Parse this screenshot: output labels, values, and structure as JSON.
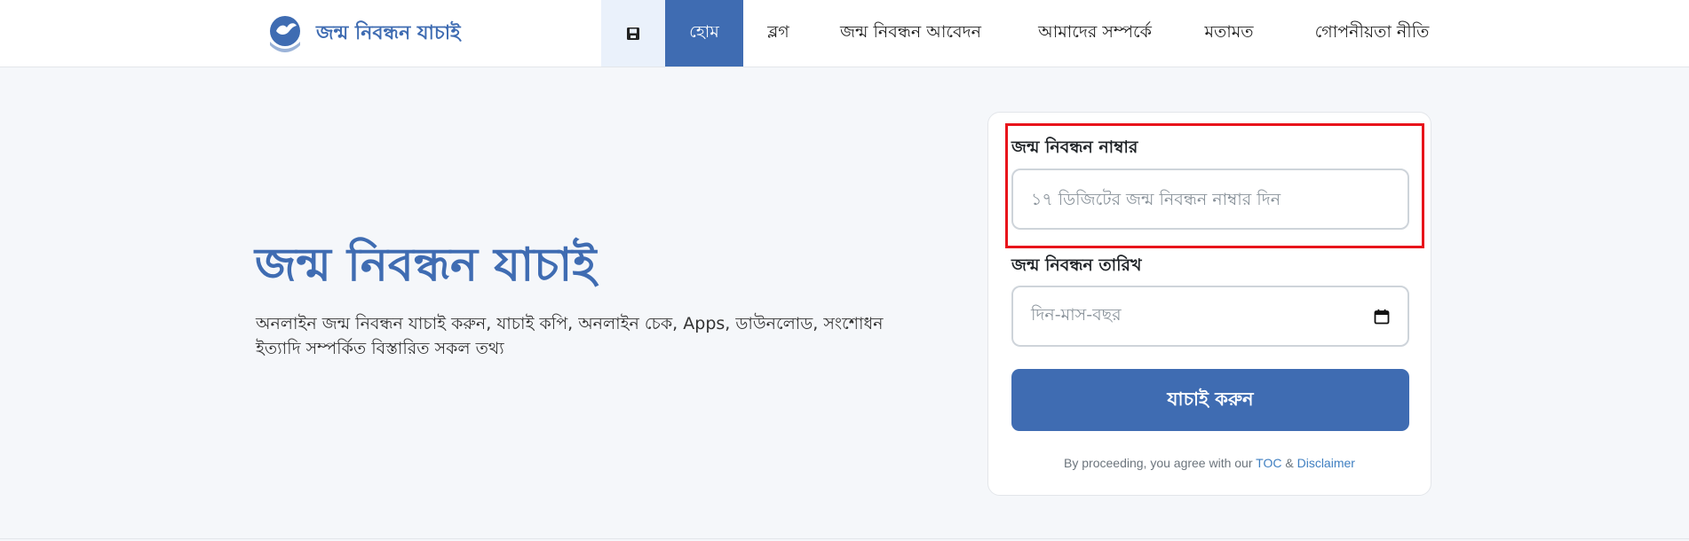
{
  "header": {
    "brand": "জন্ম নিবন্ধন যাচাই",
    "logo_icon": "dove-hands-logo",
    "nav": {
      "save_icon": "save-icon",
      "home": "হোম",
      "blog": "ব্লগ",
      "apply": "জন্ম নিবন্ধন আবেদন",
      "about": "আমাদের সম্পর্কে",
      "opinion": "মতামত",
      "privacy": "গোপনীয়তা নীতি"
    },
    "active_item": "home"
  },
  "hero": {
    "title": "জন্ম নিবন্ধন যাচাই",
    "description": "অনলাইন জন্ম নিবন্ধন যাচাই করুন, যাচাই কপি, অনলাইন চেক, Apps, ডাউনলোড, সংশোধন ইত্যাদি সম্পর্কিত বিস্তারিত সকল তথ্য"
  },
  "form": {
    "number_label": "জন্ম নিবন্ধন নাম্বার",
    "number_placeholder": "১৭ ডিজিটের জন্ম নিবন্ধন নাম্বার দিন",
    "number_value": "",
    "date_label": "জন্ম নিবন্ধন তারিখ",
    "date_placeholder": "দিন-মাস-বছর",
    "date_icon": "calendar-icon",
    "submit": "যাচাই করুন",
    "terms_prefix": "By proceeding, you agree with our",
    "terms_toc": "TOC",
    "terms_and": "&",
    "terms_disclaimer": "Disclaimer"
  },
  "colors": {
    "brand": "#3f6cb2",
    "highlight": "#e8141b",
    "link": "#3f7fc1"
  }
}
